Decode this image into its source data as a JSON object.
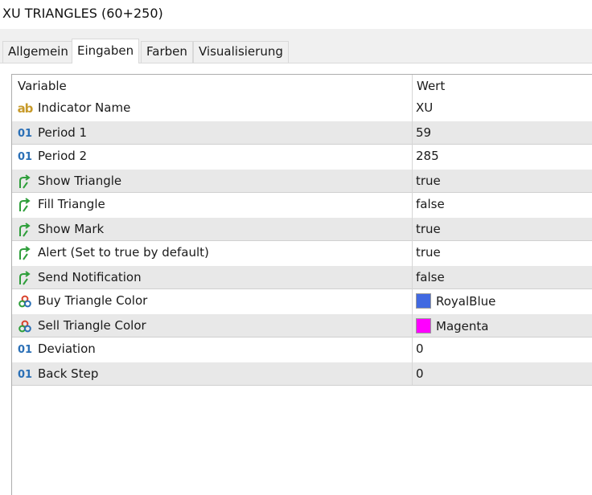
{
  "window": {
    "title": "XU TRIANGLES (60+250)"
  },
  "tabs": [
    {
      "label": "Allgemein"
    },
    {
      "label": "Eingaben"
    },
    {
      "label": "Farben"
    },
    {
      "label": "Visualisierung"
    }
  ],
  "active_tab": "Eingaben",
  "grid": {
    "headers": {
      "variable": "Variable",
      "value": "Wert"
    },
    "rows": [
      {
        "icon": "string-ab-icon",
        "name": "Indicator Name",
        "value": "XU"
      },
      {
        "icon": "integer-01-icon",
        "name": "Period 1",
        "value": "59"
      },
      {
        "icon": "integer-01-icon",
        "name": "Period 2",
        "value": "285"
      },
      {
        "icon": "boolean-arrow-icon",
        "name": "Show Triangle",
        "value": "true"
      },
      {
        "icon": "boolean-arrow-icon",
        "name": "Fill Triangle",
        "value": "false"
      },
      {
        "icon": "boolean-arrow-icon",
        "name": "Show Mark",
        "value": "true"
      },
      {
        "icon": "boolean-arrow-icon",
        "name": "Alert (Set to true by default)",
        "value": "true"
      },
      {
        "icon": "boolean-arrow-icon",
        "name": "Send Notification",
        "value": "false"
      },
      {
        "icon": "color-circles-icon",
        "name": "Buy Triangle Color",
        "value": "RoyalBlue",
        "swatch": "#4169e1"
      },
      {
        "icon": "color-circles-icon",
        "name": "Sell Triangle Color",
        "value": "Magenta",
        "swatch": "#ff00ff"
      },
      {
        "icon": "integer-01-icon",
        "name": "Deviation",
        "value": "0"
      },
      {
        "icon": "integer-01-icon",
        "name": "Back Step",
        "value": "0"
      }
    ]
  },
  "colors": {
    "string_icon": "#c79a2a",
    "integer_icon": "#2a6fb6",
    "bool_icon": "#2e9e3a",
    "row_shade": "#e8e8e8"
  }
}
